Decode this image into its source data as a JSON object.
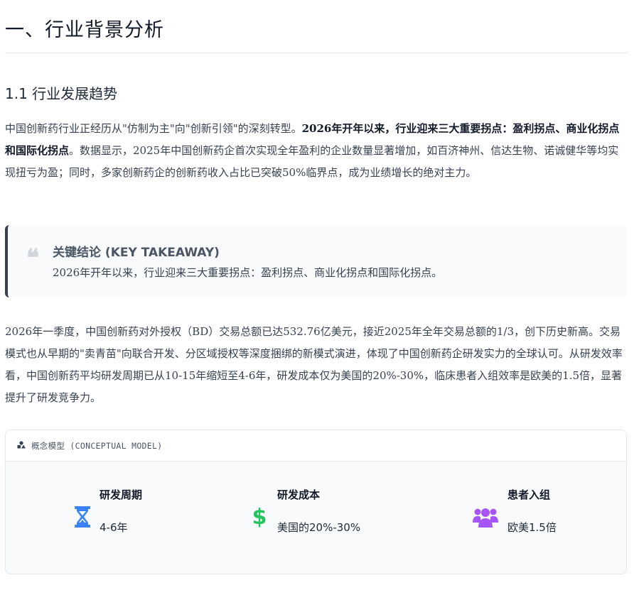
{
  "heading": "一、行业背景分析",
  "subheading": "1.1 行业发展趋势",
  "paragraph1": {
    "lead": "中国创新药行业正经历从\"仿制为主\"向\"创新引领\"的深刻转型。",
    "bold": "2026年开年以来，行业迎来三大重要拐点：盈利拐点、商业化拐点和国际化拐点",
    "rest": "。数据显示，2025年中国创新药企首次实现全年盈利的企业数量显著增加，如百济神州、信达生物、诺诚健华等均实现扭亏为盈；同时，多家创新药企的创新药收入占比已突破50%临界点，成为业绩增长的绝对主力。"
  },
  "takeaway": {
    "title": "关键结论 (KEY TAKEAWAY)",
    "text": "2026年开年以来，行业迎来三大重要拐点：盈利拐点、商业化拐点和国际化拐点。"
  },
  "paragraph2": "2026年一季度，中国创新药对外授权（BD）交易总额已达532.76亿美元，接近2025年全年交易总额的1/3，创下历史新高。交易模式也从早期的\"卖青苗\"向联合开发、分区域授权等深度捆绑的新模式演进，体现了中国创新药企研发实力的全球认可。从研发效率看，中国创新药平均研发周期已从10-15年缩短至4-6年，研发成本仅为美国的20%-30%，临床患者入组效率是欧美的1.5倍，显著提升了研发竞争力。",
  "model": {
    "header": "概念模型 (CONCEPTUAL MODEL)",
    "items": [
      {
        "title": "研发周期",
        "value": "4-6年",
        "icon": "hourglass-icon",
        "color": "#3b82f6"
      },
      {
        "title": "研发成本",
        "value": "美国的20%-30%",
        "icon": "dollar-icon",
        "color": "#22c55e"
      },
      {
        "title": "患者入组",
        "value": "欧美1.5倍",
        "icon": "users-icon",
        "color": "#a855f7"
      }
    ]
  }
}
